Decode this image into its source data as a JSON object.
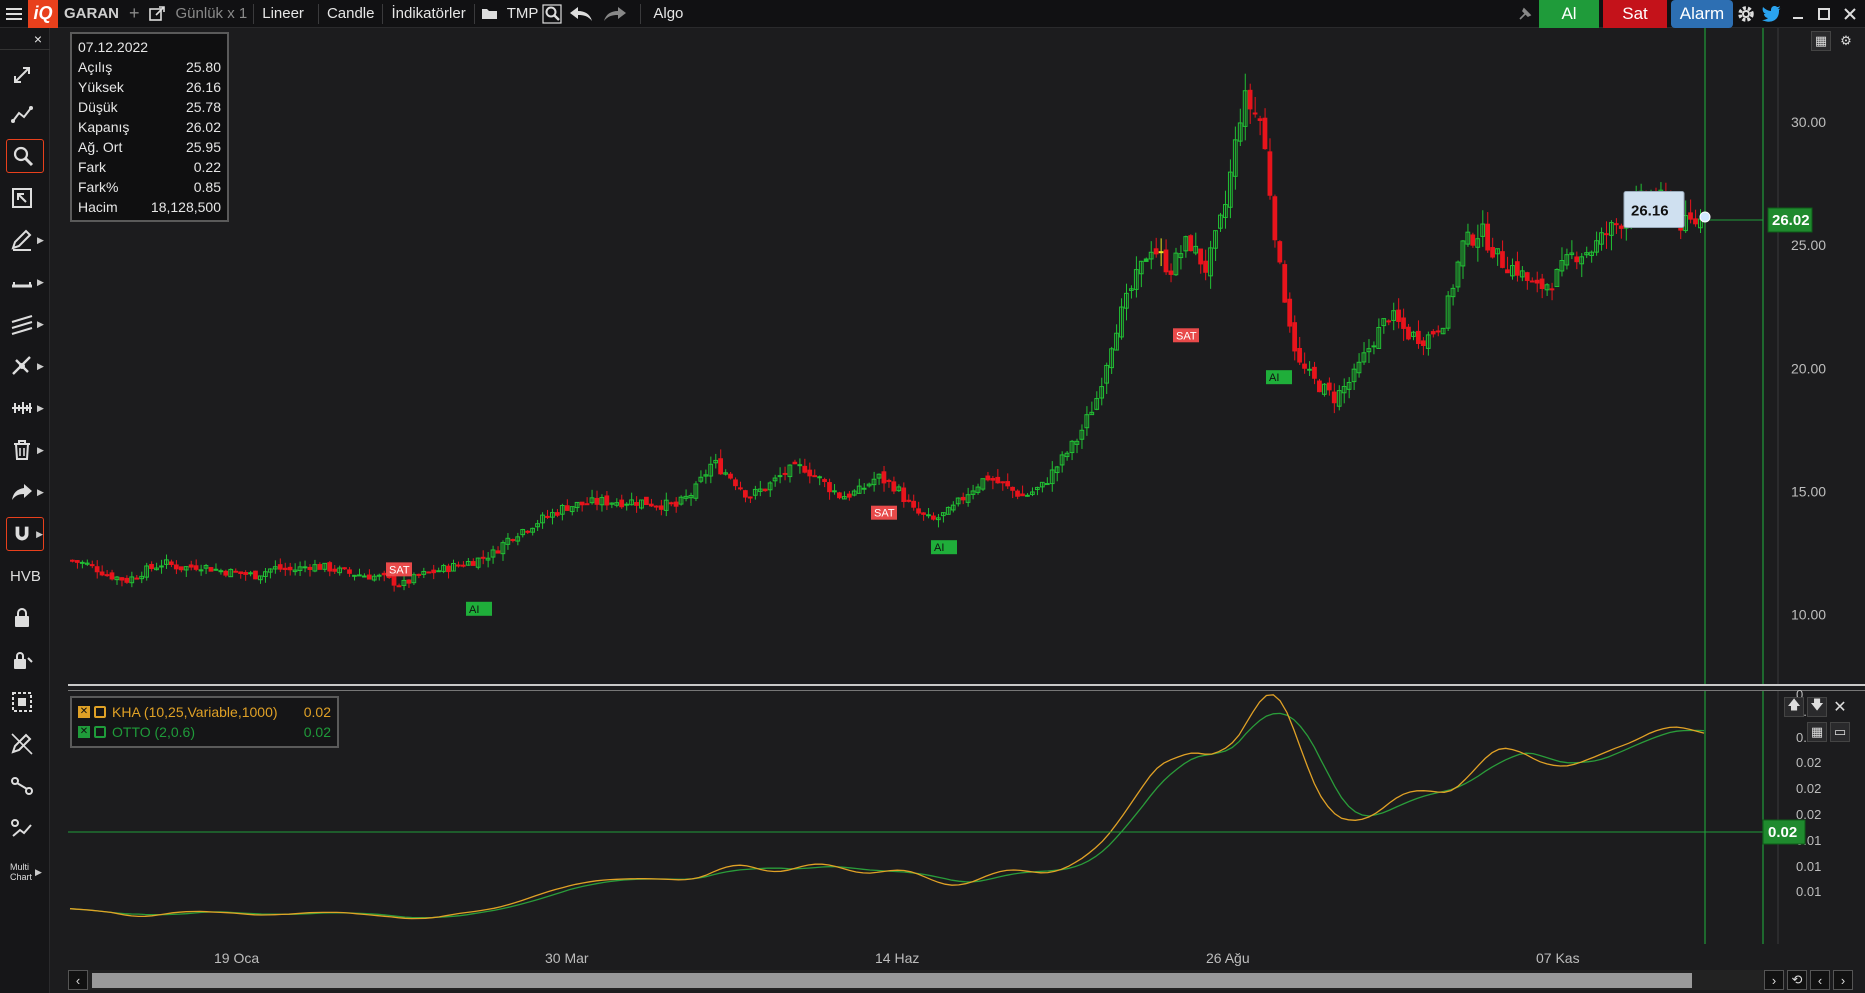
{
  "topbar": {
    "symbol": "GARAN",
    "plus": "+",
    "period": "Günlük x 1",
    "scale": "Lineer",
    "chart_type": "Candle",
    "indicators": "İndikatörler",
    "tmp": "TMP",
    "algo": "Algo",
    "buy_label": "Al",
    "sell_label": "Sat",
    "alarm_label": "Alarm",
    "logo": "iQ"
  },
  "left_tools": {
    "close_x": "×",
    "hvb": "HVB",
    "multi_chart_line1": "Multi",
    "multi_chart_line2": "Chart"
  },
  "info_box": {
    "date": "07.12.2022",
    "rows": [
      {
        "label": "Açılış",
        "value": "25.80"
      },
      {
        "label": "Yüksek",
        "value": "26.16"
      },
      {
        "label": "Düşük",
        "value": "25.78"
      },
      {
        "label": "Kapanış",
        "value": "26.02"
      },
      {
        "label": "Ağ. Ort",
        "value": "25.95"
      },
      {
        "label": "Fark",
        "value": "0.22"
      },
      {
        "label": "Fark%",
        "value": "0.85"
      },
      {
        "label": "Hacim",
        "value": "18,128,500"
      }
    ]
  },
  "indicator_legend": [
    {
      "name": "KHA (10,25,Variable,1000)",
      "value": "0.02",
      "color": "#e0a126"
    },
    {
      "name": "OTTO (2,0.6)",
      "value": "0.02",
      "color": "#1f9b3a"
    }
  ],
  "main_axis": {
    "ticks": [
      "30.00",
      "25.00",
      "20.00",
      "15.00",
      "10.00"
    ],
    "last_price": "26.02",
    "hover_price": "26.16"
  },
  "ind_axis": {
    "ticks": [
      "0",
      "0.02",
      "0.02",
      "0.02",
      "0.02",
      "0.02",
      "0.01",
      "0.01",
      "0.01"
    ],
    "crosshair_value": "0.02"
  },
  "x_axis": {
    "labels": [
      "19 Oca",
      "30 Mar",
      "14 Haz",
      "26 Ağu",
      "07 Kas"
    ]
  },
  "signals": [
    {
      "label": "SAT",
      "type": "sell"
    },
    {
      "label": "AI",
      "type": "buy"
    },
    {
      "label": "SAT",
      "type": "sell"
    },
    {
      "label": "AI",
      "type": "buy"
    },
    {
      "label": "SAT",
      "type": "sell"
    },
    {
      "label": "AI",
      "type": "buy"
    }
  ],
  "colors": {
    "up": "#21c134",
    "down": "#e8141c",
    "flat": "#e8e020",
    "kha": "#e0a126",
    "otto": "#2a9c3a",
    "crosshair": "#1f9b3a"
  },
  "chart_data": [
    {
      "type": "candlestick",
      "title": "",
      "ylim": [
        8.0,
        33.0
      ],
      "x_labels": [
        "19 Oca",
        "30 Mar",
        "14 Haz",
        "26 Ağu",
        "07 Kas"
      ],
      "close_path_y": [
        12.2,
        12.0,
        11.6,
        11.4,
        11.8,
        12.1,
        11.9,
        12.0,
        11.8,
        11.7,
        11.6,
        11.9,
        11.8,
        12.0,
        11.9,
        11.7,
        11.6,
        11.5,
        11.2,
        11.6,
        11.8,
        12.0,
        12.2,
        12.5,
        13.2,
        13.6,
        14.0,
        14.4,
        14.5,
        14.6,
        14.6,
        14.6,
        14.5,
        14.4,
        15.0,
        16.2,
        15.6,
        14.8,
        15.2,
        15.8,
        16.0,
        15.4,
        14.8,
        15.0,
        15.6,
        15.2,
        14.2,
        13.8,
        14.2,
        15.0,
        15.6,
        15.2,
        14.8,
        15.2,
        16.2,
        17.2,
        18.8,
        21.6,
        23.4,
        25.0,
        24.0,
        25.2,
        24.0,
        26.5,
        31.0,
        30.0,
        24.0,
        20.2,
        19.4,
        18.8,
        19.6,
        21.0,
        22.2,
        21.4,
        21.2,
        22.0,
        25.0,
        25.6,
        24.4,
        24.0,
        23.2,
        23.6,
        24.6,
        24.8,
        25.6,
        26.2,
        27.0,
        26.8,
        25.8,
        26.02
      ],
      "last_close": 26.02,
      "last_high": 26.16
    },
    {
      "type": "line",
      "title": "",
      "series": [
        {
          "name": "KHA (10,25,Variable,1000)"
        },
        {
          "name": "OTTO (2,0.6)"
        }
      ]
    }
  ]
}
